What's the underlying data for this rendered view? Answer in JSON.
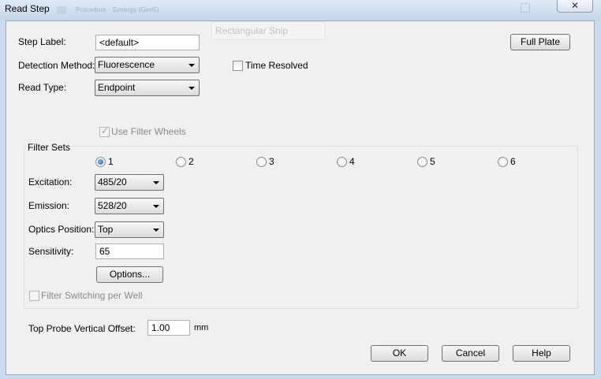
{
  "window": {
    "title": "Read Step",
    "close_label": "✕",
    "background_ghost_text": "Procedure · Synergy (Gen5)",
    "background_ghost_snip": "Rectangular Snip"
  },
  "step_label": {
    "label": "Step Label:",
    "value": "<default>"
  },
  "full_plate_button": "Full Plate",
  "detection_method": {
    "label": "Detection Method:",
    "value": "Fluorescence"
  },
  "time_resolved": {
    "label": "Time Resolved",
    "checked": false
  },
  "read_type": {
    "label": "Read Type:",
    "value": "Endpoint"
  },
  "use_filter_wheels": {
    "label": "Use Filter Wheels",
    "checked": true,
    "enabled": false
  },
  "filter_sets": {
    "title": "Filter Sets",
    "selected": "1",
    "options": [
      "1",
      "2",
      "3",
      "4",
      "5",
      "6"
    ],
    "excitation": {
      "label": "Excitation:",
      "value": "485/20"
    },
    "emission": {
      "label": "Emission:",
      "value": "528/20"
    },
    "optics_position": {
      "label": "Optics Position:",
      "value": "Top"
    },
    "sensitivity": {
      "label": "Sensitivity:",
      "value": "65"
    },
    "options_button": "Options...",
    "filter_switching": {
      "label": "Filter Switching per Well",
      "checked": false,
      "enabled": false
    }
  },
  "top_probe": {
    "label": "Top Probe Vertical Offset:",
    "value": "1.00",
    "unit": "mm"
  },
  "buttons": {
    "ok": "OK",
    "cancel": "Cancel",
    "help": "Help"
  }
}
